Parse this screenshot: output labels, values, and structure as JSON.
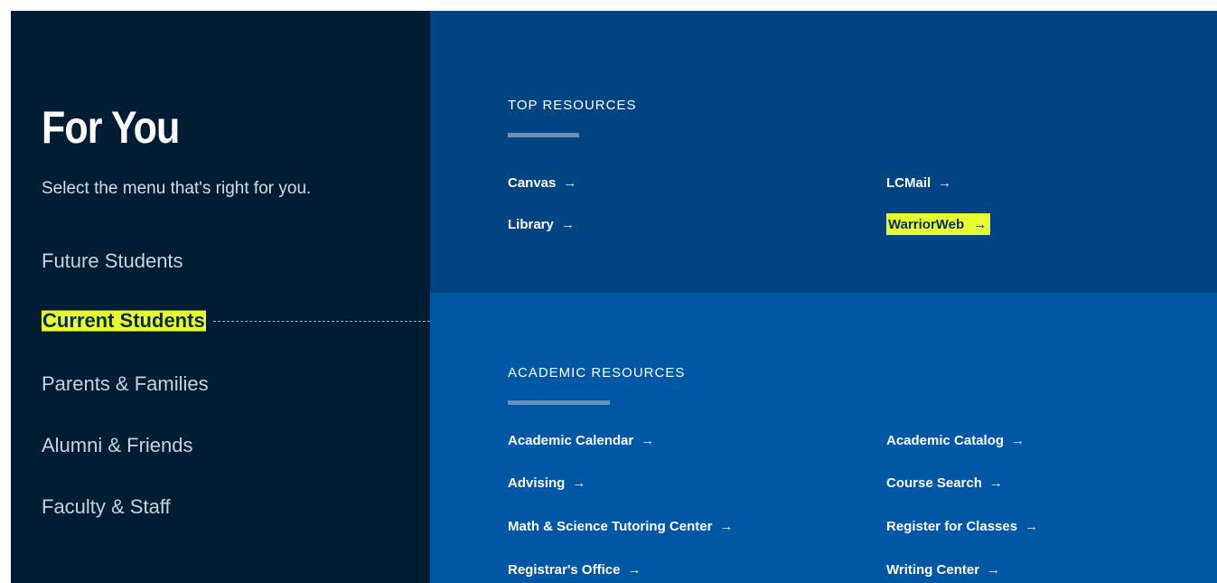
{
  "colors": {
    "sidebar_bg": "#001d33",
    "top_bg": "#004481",
    "bottom_bg": "#0057a6",
    "highlight": "#e7ff2e"
  },
  "sidebar": {
    "title": "For You",
    "subtitle": "Select the menu that's right for you.",
    "items": [
      {
        "label": "Future Students",
        "active": false
      },
      {
        "label": "Current Students",
        "active": true
      },
      {
        "label": "Parents & Families",
        "active": false
      },
      {
        "label": "Alumni & Friends",
        "active": false
      },
      {
        "label": "Faculty & Staff",
        "active": false
      }
    ]
  },
  "top_resources": {
    "heading": "TOP RESOURCES",
    "links": [
      {
        "label": "Canvas",
        "arrow": "→"
      },
      {
        "label": "LCMail",
        "arrow": "→"
      },
      {
        "label": "Library",
        "arrow": "→"
      },
      {
        "label": "WarriorWeb",
        "arrow": "→",
        "highlighted": true
      }
    ]
  },
  "academic_resources": {
    "heading": "ACADEMIC RESOURCES",
    "links": [
      {
        "label": "Academic Calendar",
        "arrow": "→"
      },
      {
        "label": "Academic Catalog",
        "arrow": "→"
      },
      {
        "label": "Advising",
        "arrow": "→"
      },
      {
        "label": "Course Search",
        "arrow": "→"
      },
      {
        "label": "Math & Science Tutoring Center",
        "arrow": "→"
      },
      {
        "label": "Register for Classes",
        "arrow": "→"
      },
      {
        "label": "Registrar's Office",
        "arrow": "→"
      },
      {
        "label": "Writing Center",
        "arrow": "→"
      }
    ]
  }
}
